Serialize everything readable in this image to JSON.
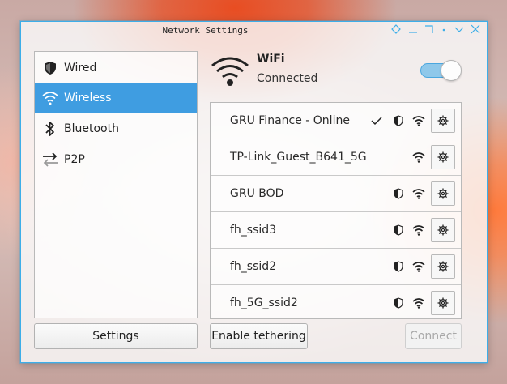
{
  "window": {
    "title": "Network Settings"
  },
  "sidebar": {
    "items": [
      {
        "label": "Wired",
        "icon": "shield-icon"
      },
      {
        "label": "Wireless",
        "icon": "wifi-icon"
      },
      {
        "label": "Bluetooth",
        "icon": "bluetooth-icon"
      },
      {
        "label": "P2P",
        "icon": "swap-arrows-icon"
      }
    ],
    "selected": "Wireless"
  },
  "header": {
    "title": "WiFi",
    "status": "Connected",
    "enabled": true
  },
  "networks": [
    {
      "name": "GRU Finance - Online",
      "connected": true,
      "secured": true
    },
    {
      "name": "TP-Link_Guest_B641_5G",
      "connected": false,
      "secured": false
    },
    {
      "name": "GRU BOD",
      "connected": false,
      "secured": true
    },
    {
      "name": "fh_ssid3",
      "connected": false,
      "secured": true
    },
    {
      "name": "fh_ssid2",
      "connected": false,
      "secured": true
    },
    {
      "name": "fh_5G_ssid2",
      "connected": false,
      "secured": true
    }
  ],
  "buttons": {
    "settings": "Settings",
    "tethering": "Enable tethering",
    "connect": "Connect"
  },
  "colors": {
    "accent": "#3daee9",
    "selection": "#3f9de1"
  }
}
